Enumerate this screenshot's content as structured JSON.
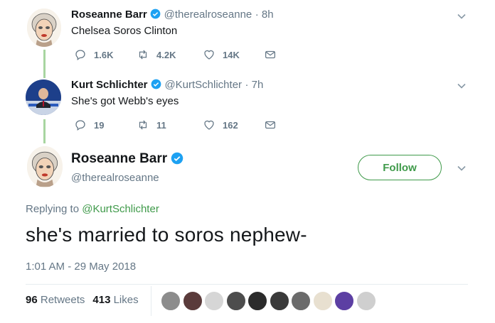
{
  "tweet1": {
    "name": "Roseanne Barr",
    "handle": "@therealroseanne",
    "time": "· 8h",
    "text": "Chelsea Soros Clinton",
    "replies": "",
    "retweets": "4.2K",
    "likes": "14K",
    "reply_count": "1.6K"
  },
  "tweet2": {
    "name": "Kurt Schlichter",
    "handle": "@KurtSchlichter",
    "time": "· 7h",
    "text": "She's got Webb's eyes",
    "reply_count": "19",
    "retweets": "11",
    "likes": "162"
  },
  "main": {
    "name": "Roseanne Barr",
    "handle": "@therealroseanne",
    "follow_label": "Follow",
    "replying_prefix": "Replying to",
    "replying_to": "@KurtSchlichter",
    "text": "she's married to soros nephew-",
    "timestamp": "1:01 AM - 29 May 2018",
    "retweets_count": "96",
    "retweets_label": "Retweets",
    "likes_count": "413",
    "likes_label": "Likes"
  },
  "colors": {
    "accent_green": "#3f9a4a",
    "verified_blue": "#1da1f2",
    "muted": "#657786"
  },
  "likers": [
    "liker-avatar",
    "liker-avatar",
    "liker-avatar",
    "liker-avatar",
    "liker-avatar",
    "liker-avatar",
    "liker-avatar",
    "liker-avatar",
    "liker-avatar",
    "liker-avatar"
  ]
}
